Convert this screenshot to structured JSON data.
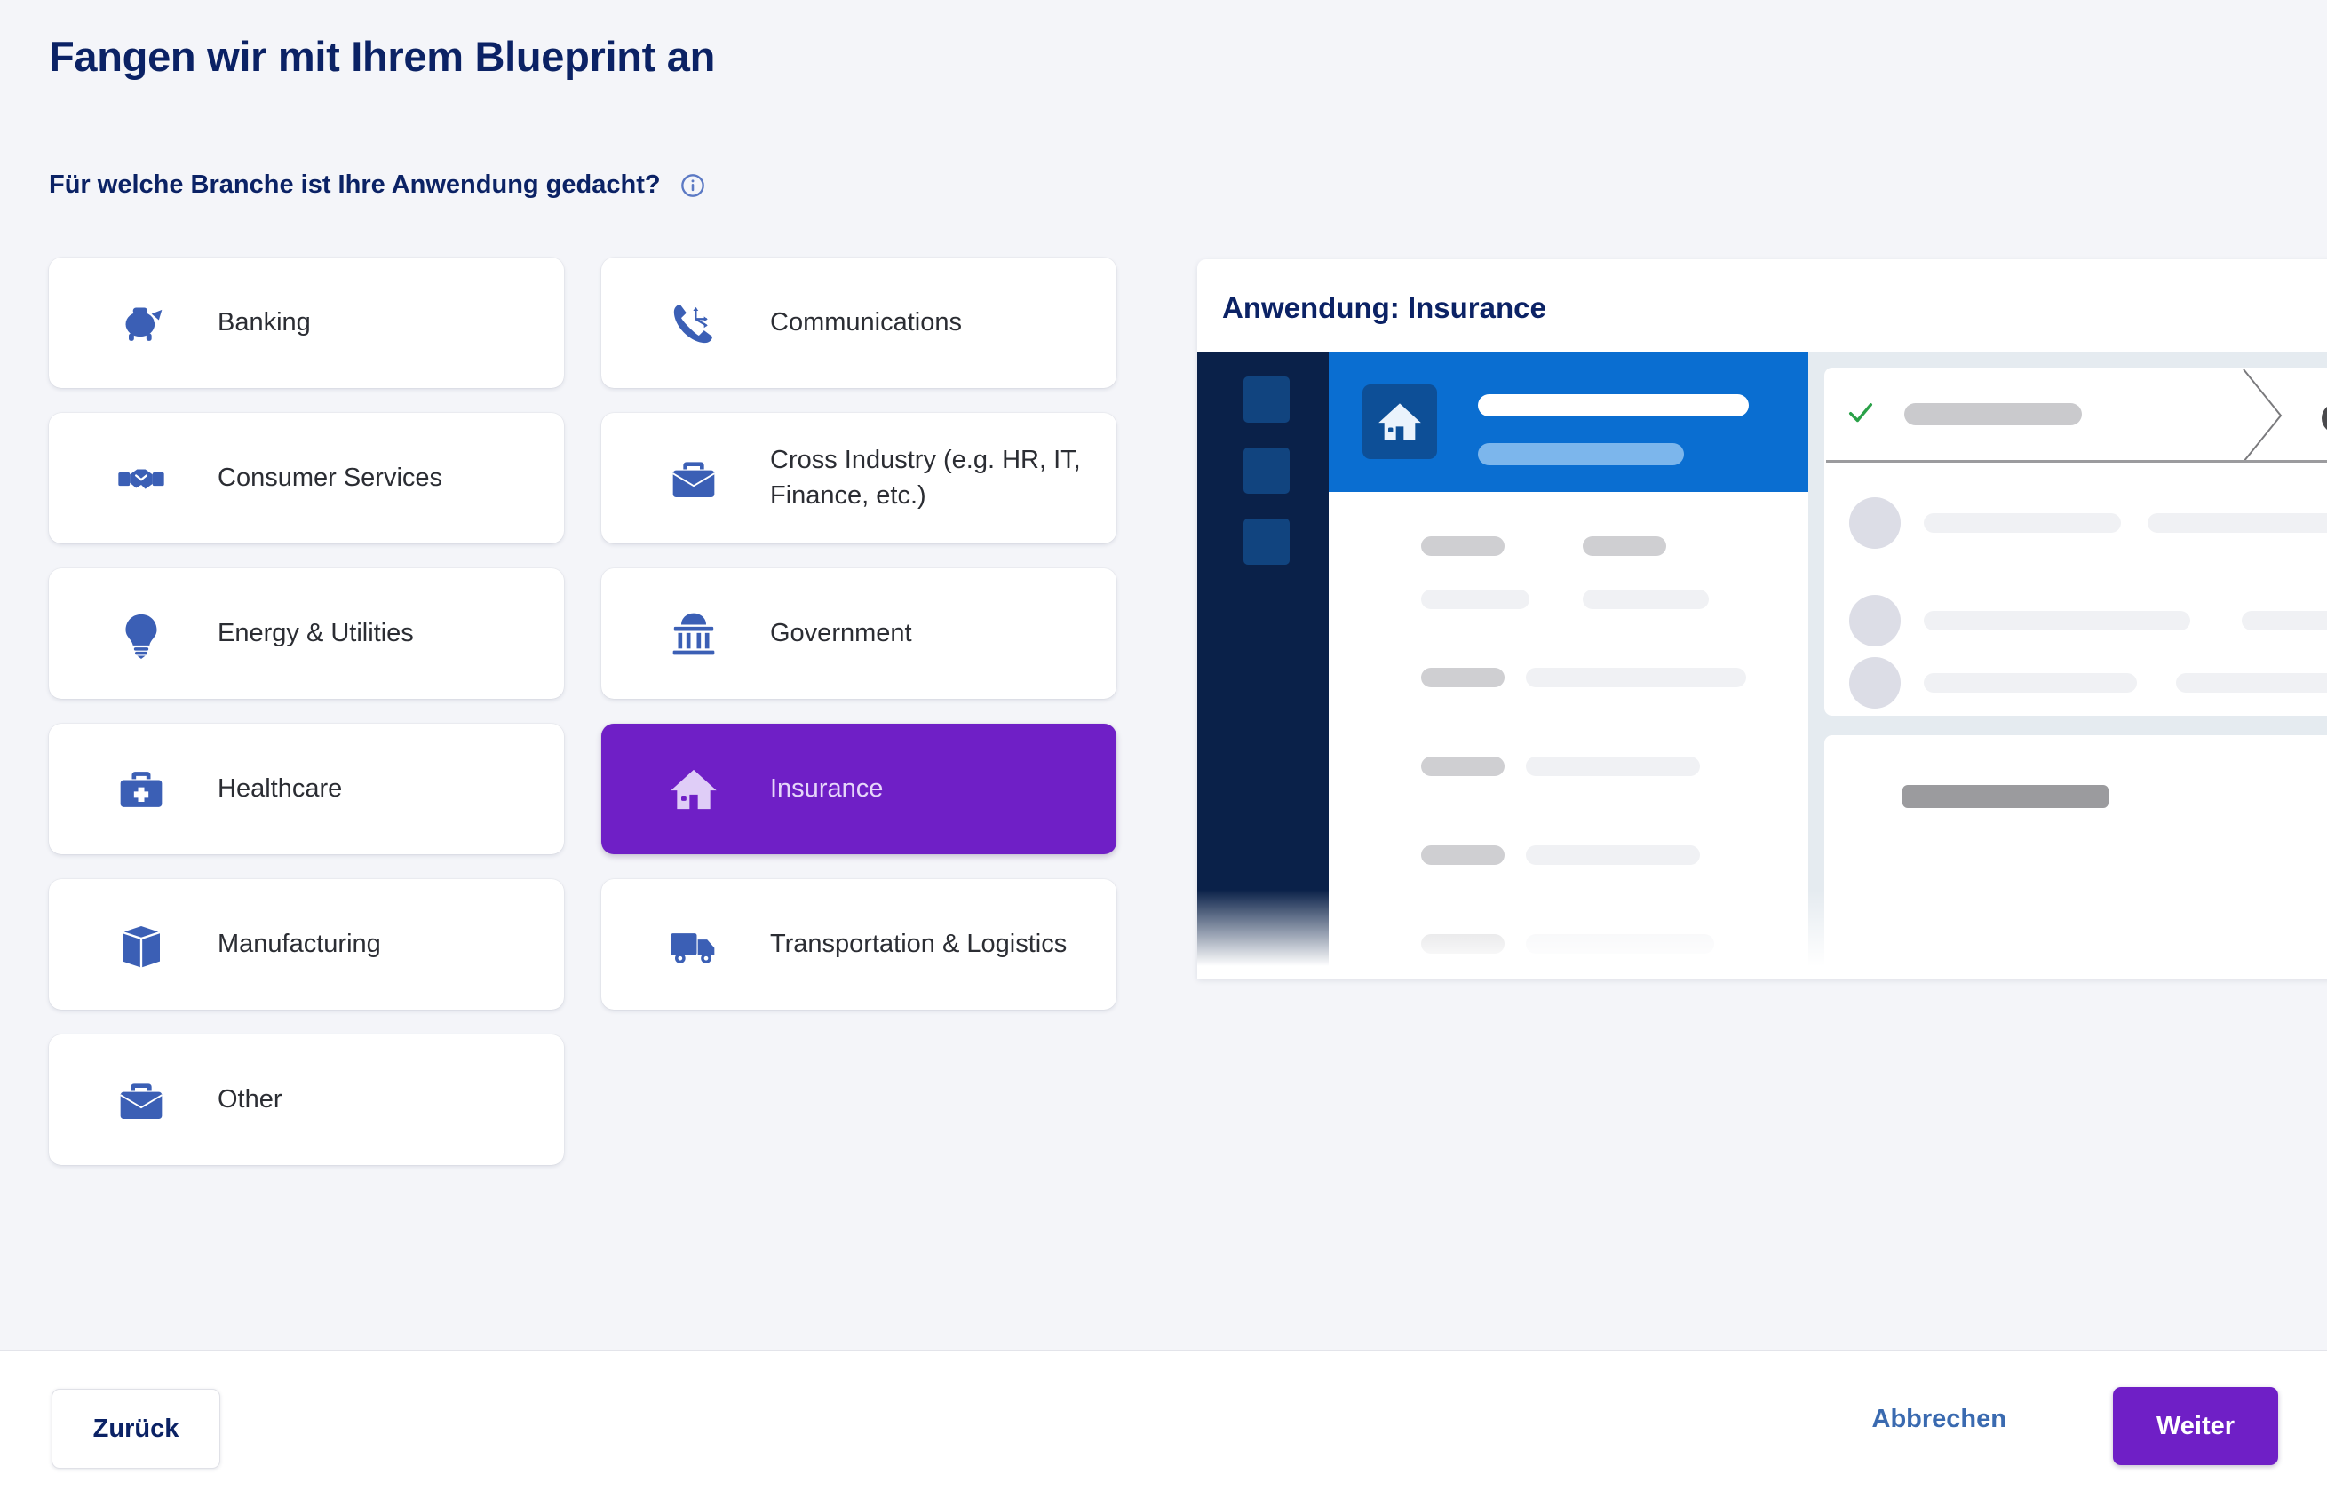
{
  "page": {
    "title": "Fangen wir mit Ihrem Blueprint an",
    "question_label": "Für welche Branche ist Ihre Anwendung gedacht?",
    "info_icon": "info-circle-icon"
  },
  "industries": {
    "left_column": [
      {
        "label": "Banking",
        "icon": "piggy-bank-icon",
        "selected": false
      },
      {
        "label": "Consumer Services",
        "icon": "handshake-icon",
        "selected": false
      },
      {
        "label": "Energy & Utilities",
        "icon": "lightbulb-icon",
        "selected": false
      },
      {
        "label": "Healthcare",
        "icon": "medical-bag-icon",
        "selected": false
      },
      {
        "label": "Manufacturing",
        "icon": "package-box-icon",
        "selected": false
      },
      {
        "label": "Other",
        "icon": "briefcase-icon",
        "selected": false
      }
    ],
    "right_column": [
      {
        "label": "Communications",
        "icon": "phone-branch-icon",
        "selected": false
      },
      {
        "label": "Cross Industry (e.g. HR, IT, Finance, etc.)",
        "icon": "briefcase-icon",
        "selected": false
      },
      {
        "label": "Government",
        "icon": "government-building-icon",
        "selected": false
      },
      {
        "label": "Insurance",
        "icon": "house-icon",
        "selected": true
      },
      {
        "label": "Transportation & Logistics",
        "icon": "truck-icon",
        "selected": false
      }
    ]
  },
  "preview": {
    "title": "Anwendung: Insurance",
    "header_icon": "house-icon",
    "status_icon": "green-check-icon",
    "chevron_icon": "chevron-right-icon"
  },
  "footer": {
    "back_label": "Zurück",
    "cancel_label": "Abbrechen",
    "next_label": "Weiter"
  },
  "colors": {
    "brand_navy": "#0b2265",
    "accent_purple": "#6f1fc6",
    "icon_blue": "#3b5fb5",
    "link_blue": "#3a6ab0",
    "page_bg": "#f4f5f9",
    "mock_sidebar": "#0a2149",
    "mock_header_blue": "#0a6ed1",
    "check_green": "#2aa148"
  }
}
